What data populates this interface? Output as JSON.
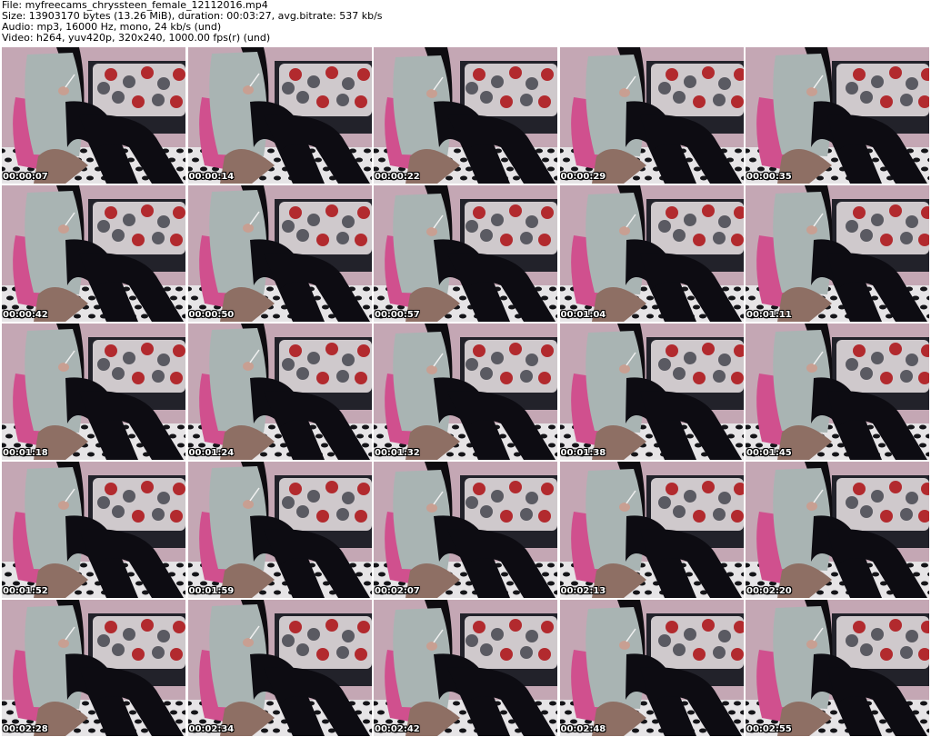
{
  "header": {
    "file_line": "File: myfreecams_chryssteen_female_12112016.mp4",
    "size_line": "Size: 13903170 bytes (13.26 MiB), duration: 00:03:27, avg.bitrate: 537 kb/s",
    "audio_line": "Audio: mp3, 16000 Hz, mono, 24 kb/s (und)",
    "video_line": "Video: h264, yuv420p, 320x240, 1000.00 fps(r) (und)"
  },
  "thumbnails": [
    {
      "timestamp": "00:00:07"
    },
    {
      "timestamp": "00:00:14"
    },
    {
      "timestamp": "00:00:22"
    },
    {
      "timestamp": "00:00:29"
    },
    {
      "timestamp": "00:00:35"
    },
    {
      "timestamp": "00:00:42"
    },
    {
      "timestamp": "00:00:50"
    },
    {
      "timestamp": "00:00:57"
    },
    {
      "timestamp": "00:01:04"
    },
    {
      "timestamp": "00:01:11"
    },
    {
      "timestamp": "00:01:18"
    },
    {
      "timestamp": "00:01:24"
    },
    {
      "timestamp": "00:01:32"
    },
    {
      "timestamp": "00:01:38"
    },
    {
      "timestamp": "00:01:45"
    },
    {
      "timestamp": "00:01:52"
    },
    {
      "timestamp": "00:01:59"
    },
    {
      "timestamp": "00:02:07"
    },
    {
      "timestamp": "00:02:13"
    },
    {
      "timestamp": "00:02:20"
    },
    {
      "timestamp": "00:02:28"
    },
    {
      "timestamp": "00:02:34"
    },
    {
      "timestamp": "00:02:42"
    },
    {
      "timestamp": "00:02:48"
    },
    {
      "timestamp": "00:02:55"
    }
  ],
  "colors": {
    "wall": "#c4a7b4",
    "pillow_pink": "#d0508e",
    "sweater": "#a9b4b3",
    "leggings": "#0d0c12",
    "dot_red": "#b22a2e",
    "dot_gray": "#5a5a62"
  }
}
